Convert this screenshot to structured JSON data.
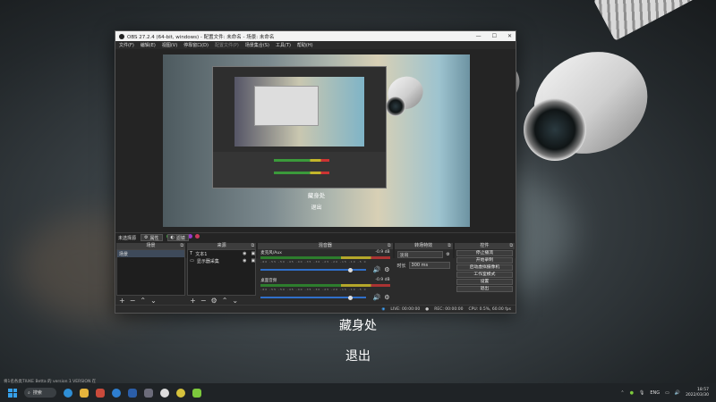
{
  "window": {
    "title": "OBS 27.2.4 (64-bit, windows) - 配置文件: 未命名 - 场景: 未命名",
    "controls": [
      "—",
      "☐",
      "✕"
    ]
  },
  "menu": [
    {
      "label": "文件(F)",
      "enabled": true
    },
    {
      "label": "编辑(E)",
      "enabled": true
    },
    {
      "label": "视图(V)",
      "enabled": true
    },
    {
      "label": "停靠窗口(D)",
      "enabled": true
    },
    {
      "label": "配置文件(P)",
      "enabled": false
    },
    {
      "label": "场景集合(S)",
      "enabled": true
    },
    {
      "label": "工具(T)",
      "enabled": true
    },
    {
      "label": "帮助(H)",
      "enabled": true
    }
  ],
  "preview": {
    "caption_title": "藏身处",
    "caption_exit": "退出"
  },
  "scene_bar": {
    "no_source": "未选择源",
    "properties": "属性",
    "filters": "滤镜"
  },
  "scenes": {
    "header": "场景",
    "items": [
      "场景"
    ],
    "footer": [
      "+",
      "−",
      "⌃",
      "⌄"
    ]
  },
  "sources": {
    "header": "来源",
    "items": [
      {
        "label": "文本1",
        "icon": "text-icon"
      },
      {
        "label": "显示器采集",
        "icon": "monitor-icon"
      }
    ],
    "footer": [
      "+",
      "−",
      "⚙",
      "⌃",
      "⌄"
    ]
  },
  "mixer": {
    "header": "混音器",
    "channels": [
      {
        "name": "麦克风/Aux",
        "db": "-0.9 dB",
        "level": 0.83
      },
      {
        "name": "桌面音频",
        "db": "-0.9 dB",
        "level": 0.83
      }
    ],
    "scale": "-60 -55 -50 -45 -40 -35 -30 -25 -20 -15 -10 -5 0"
  },
  "transitions": {
    "header": "转场特效",
    "type": "淡出",
    "duration_label": "时长",
    "duration_value": "300 ms"
  },
  "controls": {
    "header": "控件",
    "buttons": [
      "停止播流",
      "开始录制",
      "启动虚拟摄像机",
      "工作室模式",
      "设置",
      "退出"
    ]
  },
  "status": {
    "live": "LIVE: 00:00:00",
    "rec": "REC: 00:00:00",
    "cpu": "CPU: 0.5%, 60.00 fps"
  },
  "overlay": {
    "title": "藏身处",
    "exit": "退出"
  },
  "toast": "将1名各类TIUKE Betta 的 version 1 VERSION 在",
  "taskbar": {
    "search": "搜索",
    "lang": "ENG",
    "time": "18:57",
    "date": "2022/03/30"
  },
  "colors": {
    "accent": "#36a0ea",
    "meter_green": "#3b9a3b",
    "meter_yellow": "#c3b52b",
    "meter_red": "#c33",
    "slider": "#2f6fc9"
  }
}
